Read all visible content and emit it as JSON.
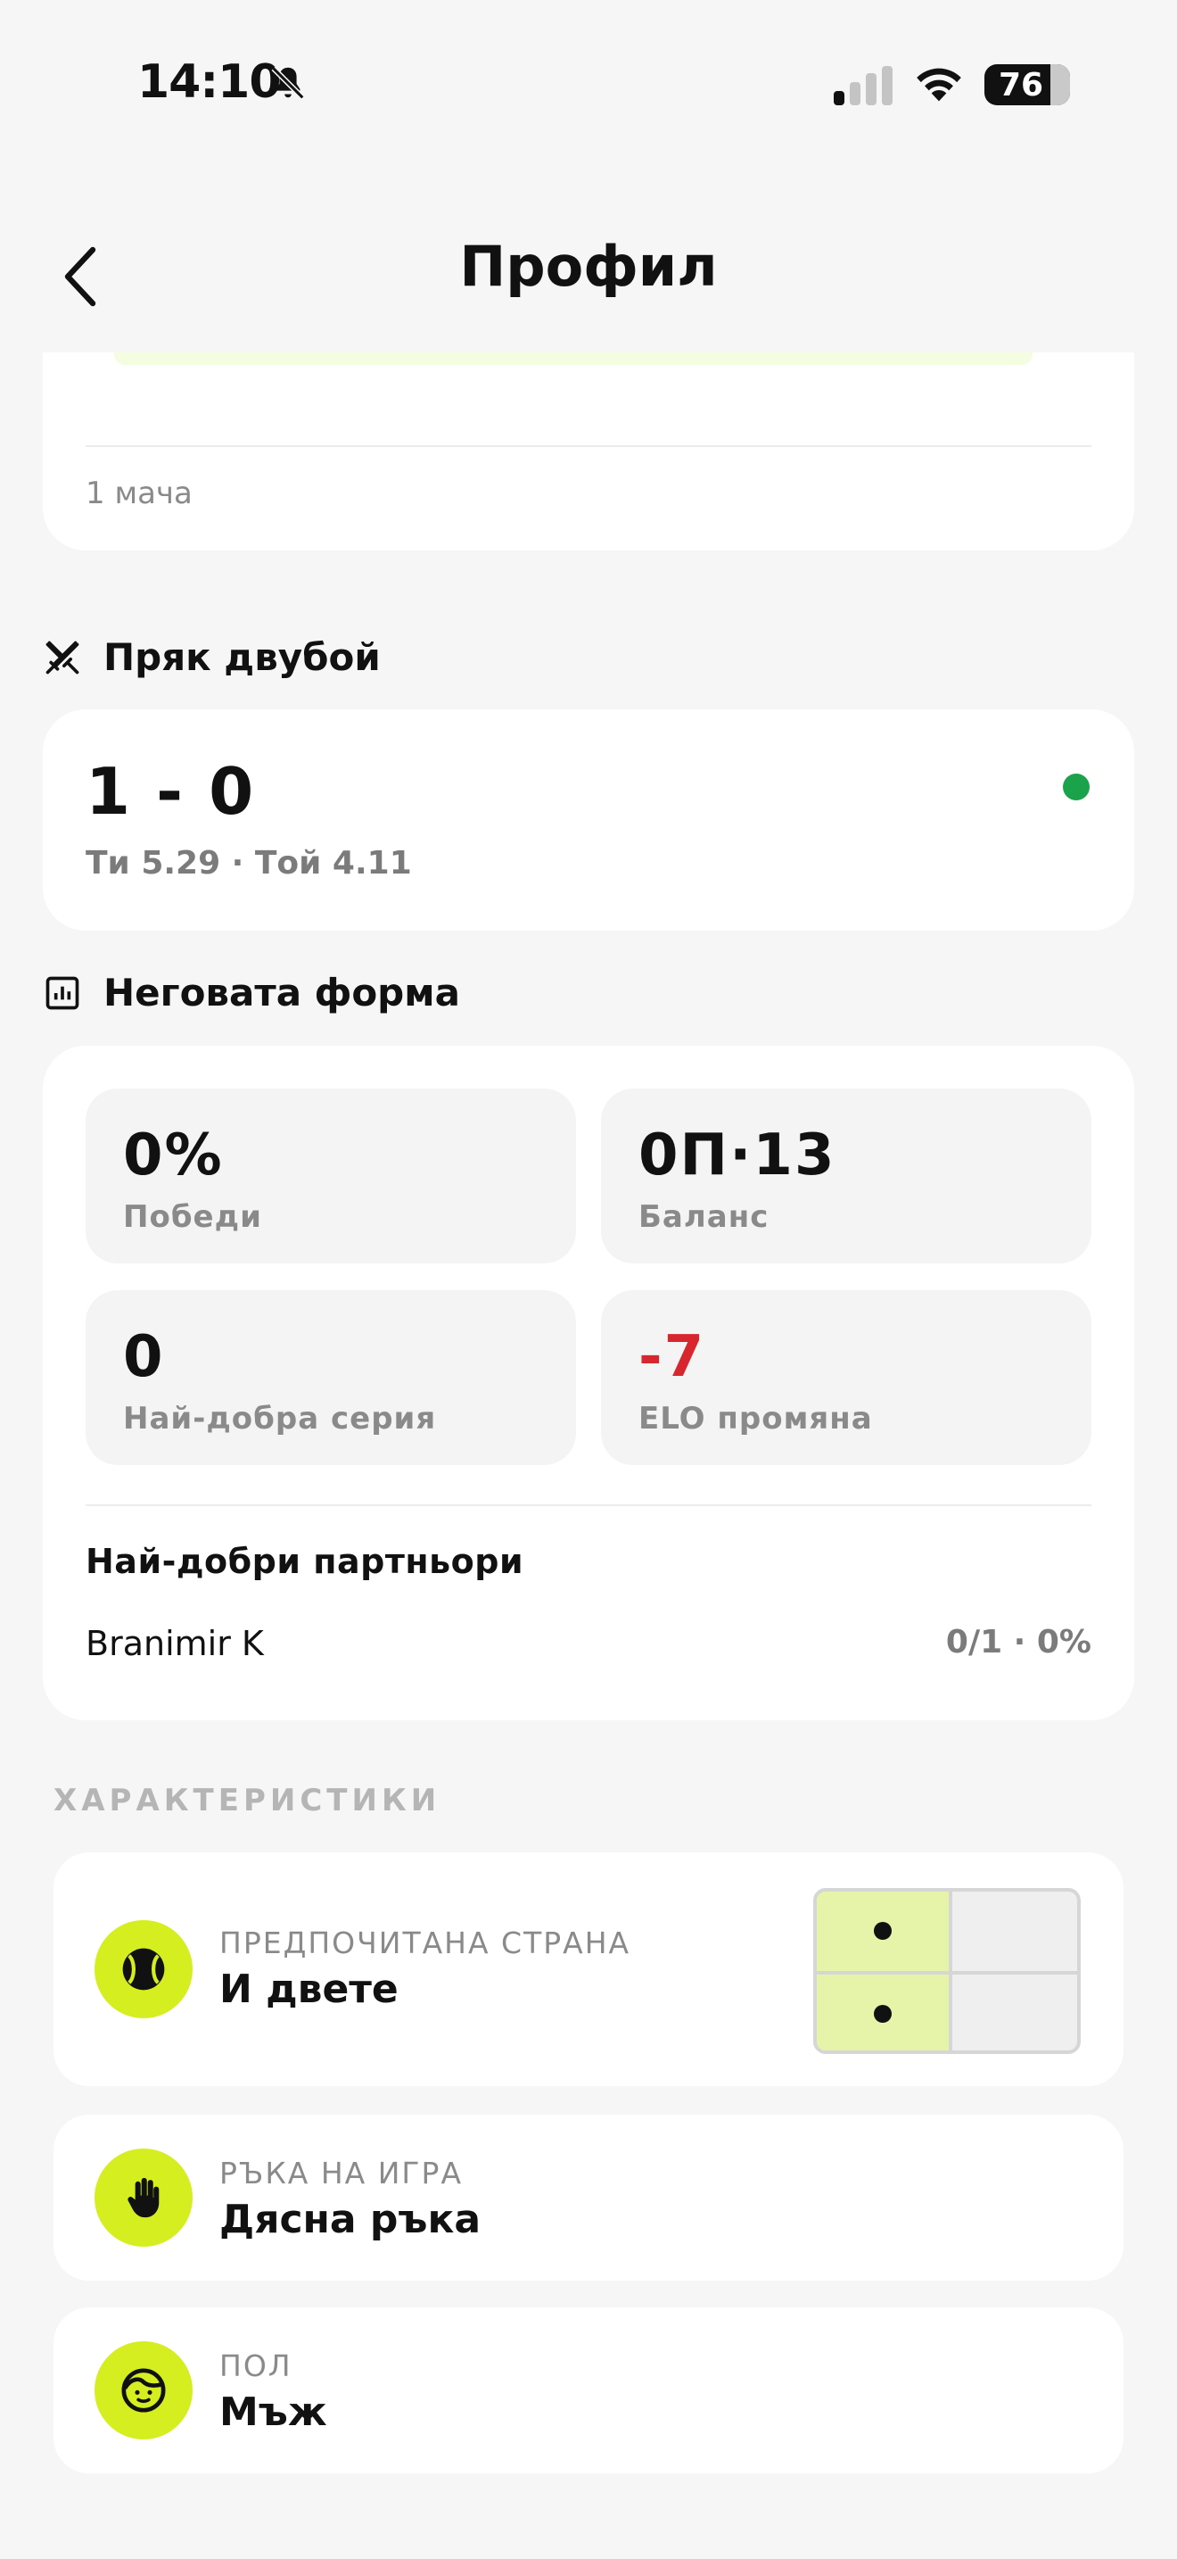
{
  "status_bar": {
    "time": "14:10",
    "battery": "76"
  },
  "header": {
    "title": "Профил"
  },
  "top_card": {
    "matches": "1 мача"
  },
  "h2h": {
    "heading": "Пряк двубой",
    "score": "1 - 0",
    "ratings": "Ти 5.29 · Той 4.11",
    "dot_color": "#1aa34a"
  },
  "form": {
    "heading": "Неговата форма",
    "stats": [
      {
        "value": "0%",
        "label": "Победи"
      },
      {
        "value": "0П·13",
        "label": "Баланс"
      },
      {
        "value": "0",
        "label": "Най-добра серия"
      },
      {
        "value": "-7",
        "label": "ELO промяна",
        "color": "#d7262e"
      }
    ],
    "partners_title": "Най-добри партньори",
    "partners": [
      {
        "name": "Branimir K",
        "stats": "0/1 · 0%"
      }
    ]
  },
  "characteristics": {
    "header": "ХАРАКТЕРИСТИКИ",
    "accent": "#d5ee1f",
    "items": [
      {
        "label": "ПРЕДПОЧИТАНА СТРАНА",
        "value": "И двете",
        "icon": "tennis-ball-icon"
      },
      {
        "label": "РЪКА НА ИГРА",
        "value": "Дясна ръка",
        "icon": "hand-icon"
      },
      {
        "label": "ПОЛ",
        "value": "Мъж",
        "icon": "face-icon"
      }
    ]
  }
}
